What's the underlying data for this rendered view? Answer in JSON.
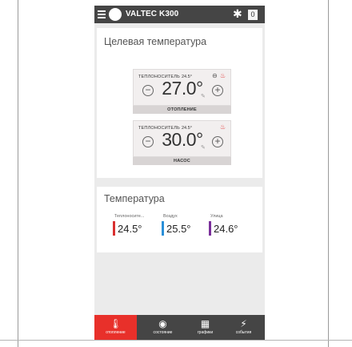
{
  "header": {
    "device_name": "VALTEC K300",
    "counter": "0",
    "icons": {
      "menu": "menu-icon",
      "device": "device-status-icon",
      "settings": "gear-icon"
    }
  },
  "target": {
    "title": "Целевая температура",
    "controls": [
      {
        "label": "ТЕПЛОНОСИТЕЛЬ",
        "current": "24.5°",
        "setpoint": "27.0°",
        "footer": "ОТОПЛЕНИЕ",
        "minus": "−",
        "plus": "+",
        "status_icons": [
          "stop-icon",
          "flame-icon"
        ]
      },
      {
        "label": "ТЕПЛОНОСИТЕЛЬ",
        "current": "24.5°",
        "setpoint": "30.0°",
        "footer": "НАСОС",
        "minus": "−",
        "plus": "+",
        "status_icons": [
          "flame-icon"
        ]
      }
    ]
  },
  "temperature": {
    "title": "Температура",
    "readings": [
      {
        "label": "Теплоносите...",
        "value": "24.5°",
        "color": "#d93030"
      },
      {
        "label": "Воздух",
        "value": "25.5°",
        "color": "#2a8fd8"
      },
      {
        "label": "Улица",
        "value": "24.6°",
        "color": "#7a2f9a"
      }
    ]
  },
  "tabs": [
    {
      "label": "отопление",
      "icon": "thermometer-icon",
      "active": true
    },
    {
      "label": "состояние",
      "icon": "status-icon",
      "active": false
    },
    {
      "label": "графики",
      "icon": "chart-icon",
      "active": false
    },
    {
      "label": "события",
      "icon": "lightning-icon",
      "active": false
    }
  ],
  "colors": {
    "accent": "#e8302a",
    "topbar": "#454545",
    "background": "#ebebeb"
  }
}
